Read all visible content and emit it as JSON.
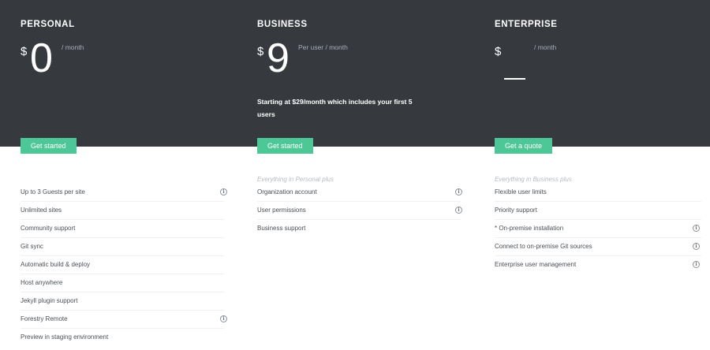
{
  "plans": [
    {
      "name": "PERSONAL",
      "currency": "$",
      "amount": "0",
      "period": "/ month",
      "blurb": "",
      "cta": "Get started",
      "lead": "",
      "features": [
        {
          "label": "Up to 3 Guests per site",
          "info": true
        },
        {
          "label": "Unlimited sites",
          "info": false
        },
        {
          "label": "Community support",
          "info": false
        },
        {
          "label": "Git sync",
          "info": false
        },
        {
          "label": "Automatic build & deploy",
          "info": false
        },
        {
          "label": "Host anywhere",
          "info": false
        },
        {
          "label": "Jekyll plugin support",
          "info": false
        },
        {
          "label": "Forestry Remote",
          "info": true
        },
        {
          "label": "Preview in staging environment",
          "info": false
        }
      ]
    },
    {
      "name": "BUSINESS",
      "currency": "$",
      "amount": "9",
      "period": "Per user / month",
      "blurb": "Starting at $29/month which includes your first 5 users",
      "cta": "Get started",
      "lead": "Everything in Personal plus",
      "features": [
        {
          "label": "Organization account",
          "info": true
        },
        {
          "label": "User permissions",
          "info": true
        },
        {
          "label": "Business support",
          "info": false
        }
      ]
    },
    {
      "name": "ENTERPRISE",
      "currency": "$",
      "amount": "",
      "period": "/ month",
      "blurb": "",
      "cta": "Get a quote",
      "lead": "Everything in Business plus",
      "features": [
        {
          "label": "Flexible user limits",
          "info": false
        },
        {
          "label": "Priority support",
          "info": false
        },
        {
          "label": "* On-premise installation",
          "info": true
        },
        {
          "label": "Connect to on-premise Git sources",
          "info": true
        },
        {
          "label": "Enterprise user management",
          "info": true
        }
      ]
    }
  ],
  "colors": {
    "hero_bg": "#363a3f",
    "accent": "#4ec796",
    "info_icon": "info-circle-icon"
  }
}
